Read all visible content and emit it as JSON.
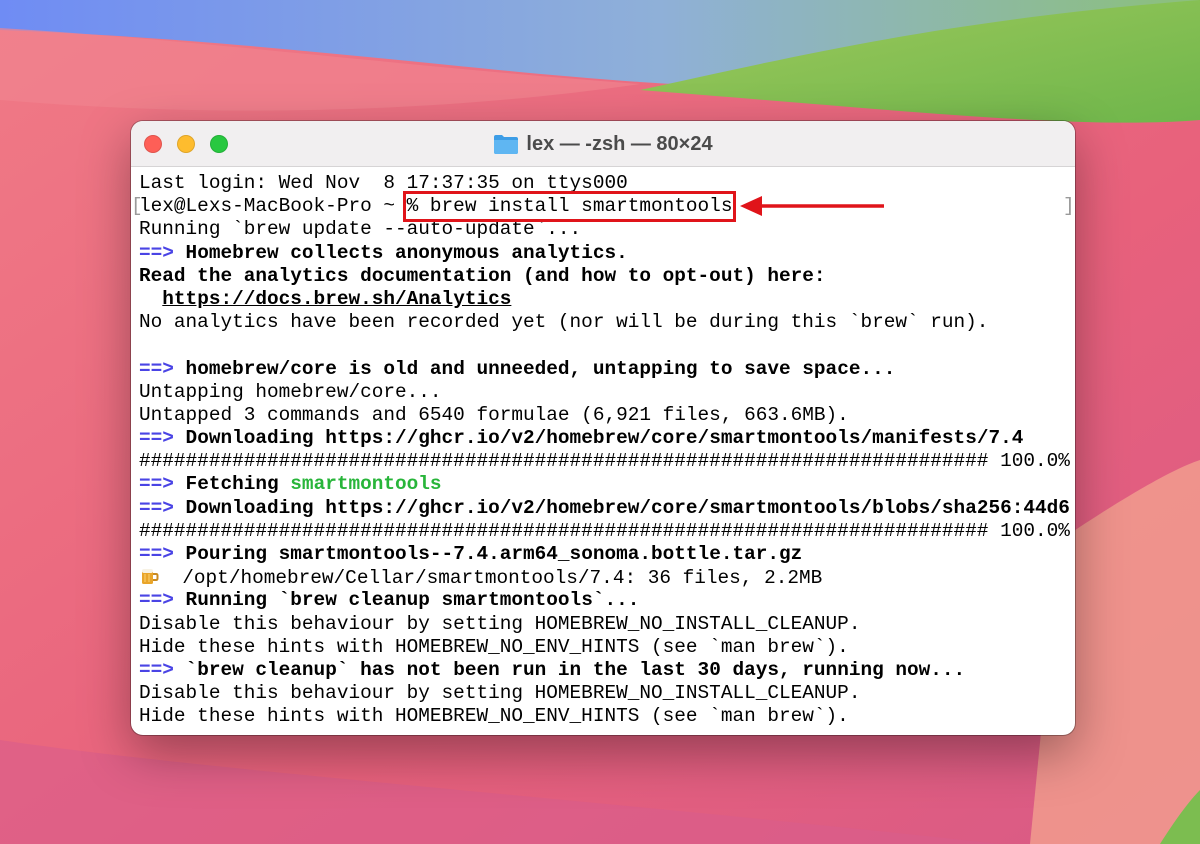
{
  "window": {
    "title": "lex — -zsh — 80×24"
  },
  "terminal": {
    "lines": [
      {
        "id": "l0",
        "text": "Last login: Wed Nov  8 17:37:35 on ttys000"
      },
      {
        "id": "l1",
        "prompt": "lex@Lexs-MacBook-Pro ~ ",
        "command": "% brew install smartmontools"
      },
      {
        "id": "l2",
        "text": "Running `brew update --auto-update`..."
      },
      {
        "id": "l3",
        "arrow": "==>",
        "text": " Homebrew collects anonymous analytics."
      },
      {
        "id": "l4",
        "text": "Read the analytics documentation (and how to opt-out) here:"
      },
      {
        "id": "l5",
        "indent": "  ",
        "text": "https://docs.brew.sh/Analytics"
      },
      {
        "id": "l6",
        "text": "No analytics have been recorded yet (nor will be during this `brew` run)."
      },
      {
        "id": "l7",
        "text": ""
      },
      {
        "id": "l8",
        "arrow": "==>",
        "text": " homebrew/core is old and unneeded, untapping to save space..."
      },
      {
        "id": "l9",
        "text": "Untapping homebrew/core..."
      },
      {
        "id": "l10",
        "text": "Untapped 3 commands and 6540 formulae (6,921 files, 663.6MB)."
      },
      {
        "id": "l11",
        "arrow": "==>",
        "text": " Downloading https://ghcr.io/v2/homebrew/core/smartmontools/manifests/7.4"
      },
      {
        "id": "l12",
        "text": "######################################################################### 100.0%"
      },
      {
        "id": "l13",
        "arrow": "==>",
        "text": " Fetching ",
        "highlight": "smartmontools"
      },
      {
        "id": "l14",
        "arrow": "==>",
        "text": " Downloading https://ghcr.io/v2/homebrew/core/smartmontools/blobs/sha256:44d6"
      },
      {
        "id": "l15",
        "text": "######################################################################### 100.0%"
      },
      {
        "id": "l16",
        "arrow": "==>",
        "text": " Pouring smartmontools--7.4.arm64_sonoma.bottle.tar.gz"
      },
      {
        "id": "l17",
        "icon": "beer-mug-icon",
        "text": "  /opt/homebrew/Cellar/smartmontools/7.4: 36 files, 2.2MB"
      },
      {
        "id": "l18",
        "arrow": "==>",
        "text": " Running `brew cleanup smartmontools`..."
      },
      {
        "id": "l19",
        "text": "Disable this behaviour by setting HOMEBREW_NO_INSTALL_CLEANUP."
      },
      {
        "id": "l20",
        "text": "Hide these hints with HOMEBREW_NO_ENV_HINTS (see `man brew`)."
      },
      {
        "id": "l21",
        "arrow": "==>",
        "text": " `brew cleanup` has not been run in the last 30 days, running now..."
      },
      {
        "id": "l22",
        "text": "Disable this behaviour by setting HOMEBREW_NO_INSTALL_CLEANUP."
      },
      {
        "id": "l23",
        "text": "Hide these hints with HOMEBREW_NO_ENV_HINTS (see `man brew`)."
      }
    ],
    "bracket_left": "[",
    "bracket_right": "]"
  },
  "colors": {
    "annotation": "#e0141a",
    "arrow_prefix": "#4a44e5",
    "highlight_green": "#28b53a"
  }
}
